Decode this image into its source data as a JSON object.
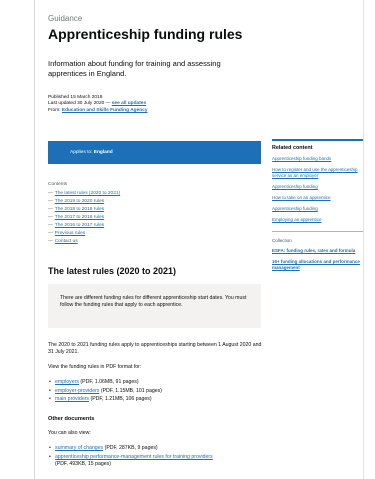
{
  "header": {
    "kicker": "Guidance",
    "title": "Apprenticeship funding rules",
    "lede": "Information about funding for training and assessing apprentices in England."
  },
  "meta": {
    "published": "Published 15 March 2019",
    "updated_prefix": "Last updated 30 July 2020 —",
    "see_all_updates": "see all updates",
    "from_label": "From:",
    "from_org": "Education and Skills Funding Agency"
  },
  "applies": {
    "label": "Applies to:",
    "value": "England"
  },
  "contents": {
    "heading": "Contents",
    "items": [
      "The latest rules (2020 to 2021)",
      "The 2019 to 2020 rules",
      "The 2018 to 2019 rules",
      "The 2017 to 2018 rules",
      "The 2016 to 2017 rules",
      "Previous rules",
      "Contact us"
    ]
  },
  "latest": {
    "title": "The latest rules (2020 to 2021)",
    "inset": "There are different funding rules for different apprenticeship start dates. You must follow the funding rules that apply to each apprentice.",
    "intro": "The 2020 to 2021 funding rules apply to apprenticeships starting between 1 August 2020 and 31 July 2021.",
    "view_text": "View the funding rules in PDF format for:",
    "pdfs": [
      {
        "link": "employers",
        "details": "(PDF, 1.06MB, 91 pages)"
      },
      {
        "link": "employer-providers",
        "details": "(PDF, 1.15MB, 101 pages)"
      },
      {
        "link": "main providers",
        "details": "(PDF, 1.21MB, 106 pages)"
      }
    ]
  },
  "other": {
    "heading": "Other documents",
    "intro": "You can also view:",
    "docs": [
      {
        "link": "summary of changes",
        "details": "(PDF, 287KB, 9 pages)"
      },
      {
        "link": "apprenticeship performance-management rules for training providers",
        "details": "(PDF, 493KB, 15 pages)"
      }
    ]
  },
  "sidebar": {
    "related_title": "Related content",
    "related": [
      "Apprenticeship funding bands",
      "How to register and use the apprenticeship service as an employer",
      "Apprenticeship funding",
      "How to take on an apprentice",
      "Apprenticeship funding",
      "Employing an apprentice"
    ],
    "collection_label": "Collection",
    "collections": [
      "ESFA: funding rules, rates and formula",
      "16+ funding allocations and performance management"
    ]
  },
  "colors": {
    "link": "#1d70b8",
    "applies_bg": "#1d70b8",
    "inset_bg": "#f3f2f1",
    "text": "#0b0c0c"
  }
}
